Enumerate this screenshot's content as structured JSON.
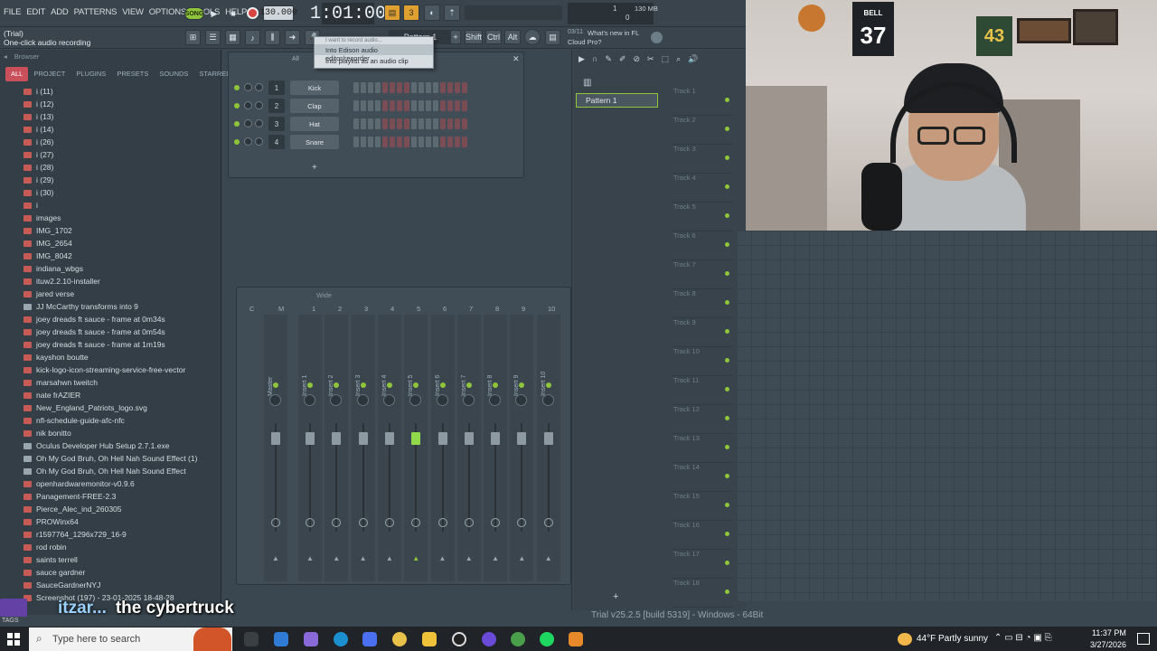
{
  "menu": [
    "FILE",
    "EDIT",
    "ADD",
    "PATTERNS",
    "VIEW",
    "OPTIONS",
    "TOOLS",
    "HELP"
  ],
  "transport": {
    "song_label": "SONG",
    "tempo": "130.000",
    "time": "1:01:00",
    "cpu_mem": "130 MB",
    "cpu_val": "1",
    "poly": "0"
  },
  "hint": {
    "line1": "(Trial)",
    "line2": "One-click audio recording"
  },
  "pattern_selector": "Pattern 1",
  "modifiers": [
    "Shift",
    "Ctrl",
    "Alt"
  ],
  "news": {
    "index": "03/11",
    "text": "What's new in FL Cloud Pro?"
  },
  "record_menu": {
    "caption": "I want to record audio...",
    "items": [
      "Into Edison audio editor/recorder",
      "Into playlist as an audio clip"
    ]
  },
  "browser": {
    "title": "Browser",
    "tabs": [
      "ALL",
      "PROJECT",
      "PLUGINS",
      "PRESETS",
      "SOUNDS",
      "STARRED"
    ],
    "items": [
      {
        "name": "i (11)",
        "type": "folder"
      },
      {
        "name": "i (12)",
        "type": "folder"
      },
      {
        "name": "i (13)",
        "type": "folder"
      },
      {
        "name": "i (14)",
        "type": "folder"
      },
      {
        "name": "i (26)",
        "type": "folder"
      },
      {
        "name": "i (27)",
        "type": "folder"
      },
      {
        "name": "i (28)",
        "type": "folder"
      },
      {
        "name": "i (29)",
        "type": "folder"
      },
      {
        "name": "i (30)",
        "type": "folder"
      },
      {
        "name": "i",
        "type": "folder"
      },
      {
        "name": "images",
        "type": "folder"
      },
      {
        "name": "IMG_1702",
        "type": "folder"
      },
      {
        "name": "IMG_2654",
        "type": "folder"
      },
      {
        "name": "IMG_8042",
        "type": "folder"
      },
      {
        "name": "indiana_wbgs",
        "type": "folder"
      },
      {
        "name": "ituw2.2.10-installer",
        "type": "folder"
      },
      {
        "name": "jared verse",
        "type": "folder"
      },
      {
        "name": "JJ McCarthy transforms into 9",
        "type": "doc"
      },
      {
        "name": "joey dreads ft sauce - frame at 0m34s",
        "type": "folder"
      },
      {
        "name": "joey dreads ft sauce - frame at 0m54s",
        "type": "folder"
      },
      {
        "name": "joey dreads ft sauce - frame at 1m19s",
        "type": "folder"
      },
      {
        "name": "kayshon boutte",
        "type": "folder"
      },
      {
        "name": "kick-logo-icon-streaming-service-free-vector",
        "type": "folder"
      },
      {
        "name": "marsahwn tweitch",
        "type": "folder"
      },
      {
        "name": "nate frAZIER",
        "type": "folder"
      },
      {
        "name": "New_England_Patriots_logo.svg",
        "type": "folder"
      },
      {
        "name": "nfl-schedule-guide-afc-nfc",
        "type": "folder"
      },
      {
        "name": "nik bonitto",
        "type": "folder"
      },
      {
        "name": "Oculus Developer Hub Setup 2.7.1.exe",
        "type": "doc"
      },
      {
        "name": "Oh My God Bruh, Oh Hell Nah Sound Effect (1)",
        "type": "doc"
      },
      {
        "name": "Oh My God Bruh, Oh Hell Nah Sound Effect",
        "type": "doc"
      },
      {
        "name": "openhardwaremonitor-v0.9.6",
        "type": "folder"
      },
      {
        "name": "Panagement-FREE-2.3",
        "type": "folder"
      },
      {
        "name": "Pierce_Alec_ind_260305",
        "type": "folder"
      },
      {
        "name": "PROWinx64",
        "type": "folder"
      },
      {
        "name": "r1597764_1296x729_16-9",
        "type": "folder"
      },
      {
        "name": "rod robin",
        "type": "folder"
      },
      {
        "name": "saints terrell",
        "type": "folder"
      },
      {
        "name": "sauce gardner",
        "type": "folder"
      },
      {
        "name": "SauceGardnerNYJ",
        "type": "folder"
      },
      {
        "name": "Screenshot (197) - 23-01-2025 18-48-28",
        "type": "folder"
      }
    ]
  },
  "channel_rack": {
    "filter": "All",
    "channels": [
      {
        "num": "1",
        "name": "Kick"
      },
      {
        "num": "2",
        "name": "Clap"
      },
      {
        "num": "3",
        "name": "Hat"
      },
      {
        "num": "4",
        "name": "Snare"
      }
    ],
    "add": "+"
  },
  "mixer": {
    "view": "Wide",
    "headers": [
      "C",
      "M",
      "1",
      "2",
      "3",
      "4",
      "5",
      "6",
      "7",
      "8",
      "9",
      "10"
    ],
    "strips": [
      "Master",
      "Insert 1",
      "Insert 2",
      "Insert 3",
      "Insert 4",
      "Insert 5",
      "Insert 6",
      "Insert 7",
      "Insert 8",
      "Insert 9",
      "Insert 10",
      "Insert 11"
    ]
  },
  "playlist": {
    "pattern": "Pattern 1",
    "tracks": [
      "Track 1",
      "Track 2",
      "Track 3",
      "Track 4",
      "Track 5",
      "Track 6",
      "Track 7",
      "Track 8",
      "Track 9",
      "Track 10",
      "Track 11",
      "Track 12",
      "Track 13",
      "Track 14",
      "Track 15",
      "Track 16",
      "Track 17",
      "Track 18"
    ]
  },
  "webcam": {
    "jersey1": "37",
    "jersey1_name": "BELL",
    "jersey2": "43"
  },
  "stream_overlay": {
    "user": "itzar...",
    "message": "the cybertruck",
    "tag": "TAGS"
  },
  "statusbar": "Trial v25.2.5 [build 5319] - Windows - 64Bit",
  "taskbar": {
    "search_placeholder": "Type here to search",
    "weather_temp": "44°F",
    "weather_text": "Partly sunny",
    "time": "11:37 PM",
    "date": "3/27/2026"
  },
  "colors": {
    "accent": "#8fc53a",
    "record": "#d9433f",
    "tab_selected": "#c94f5a"
  }
}
